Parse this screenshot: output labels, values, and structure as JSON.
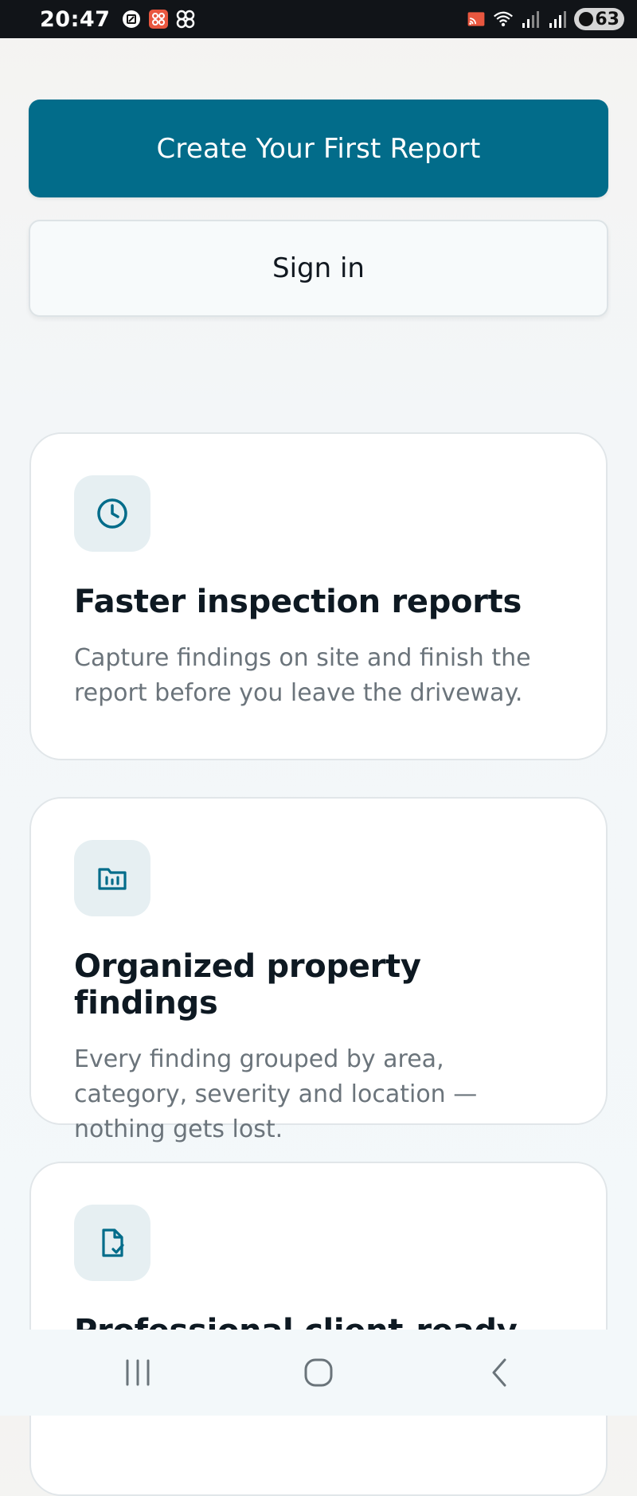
{
  "status_bar": {
    "time": "20:47",
    "battery_level": "63",
    "icons": [
      "screenshot-icon",
      "app-notification-icon",
      "fan-icon",
      "cast-icon",
      "wifi-icon",
      "signal-icon",
      "signal-icon",
      "battery-saver-icon"
    ]
  },
  "actions": {
    "primary_label": "Create Your First Report",
    "secondary_label": "Sign in"
  },
  "features": [
    {
      "icon": "clock-icon",
      "title": "Faster inspection reports",
      "description": "Capture findings on site and finish the report before you leave the driveway."
    },
    {
      "icon": "folder-chart-icon",
      "title": "Organized property findings",
      "description": "Every finding grouped by area, category, severity and location — nothing gets lost."
    },
    {
      "icon": "document-check-icon",
      "title": "Professional client-ready",
      "description": ""
    }
  ],
  "navigation": {
    "items": [
      "recent-apps-icon",
      "home-icon",
      "back-icon"
    ]
  },
  "colors": {
    "accent": "#026c8a",
    "icon_tile": "#e6eff2",
    "status_bar": "#111418"
  }
}
